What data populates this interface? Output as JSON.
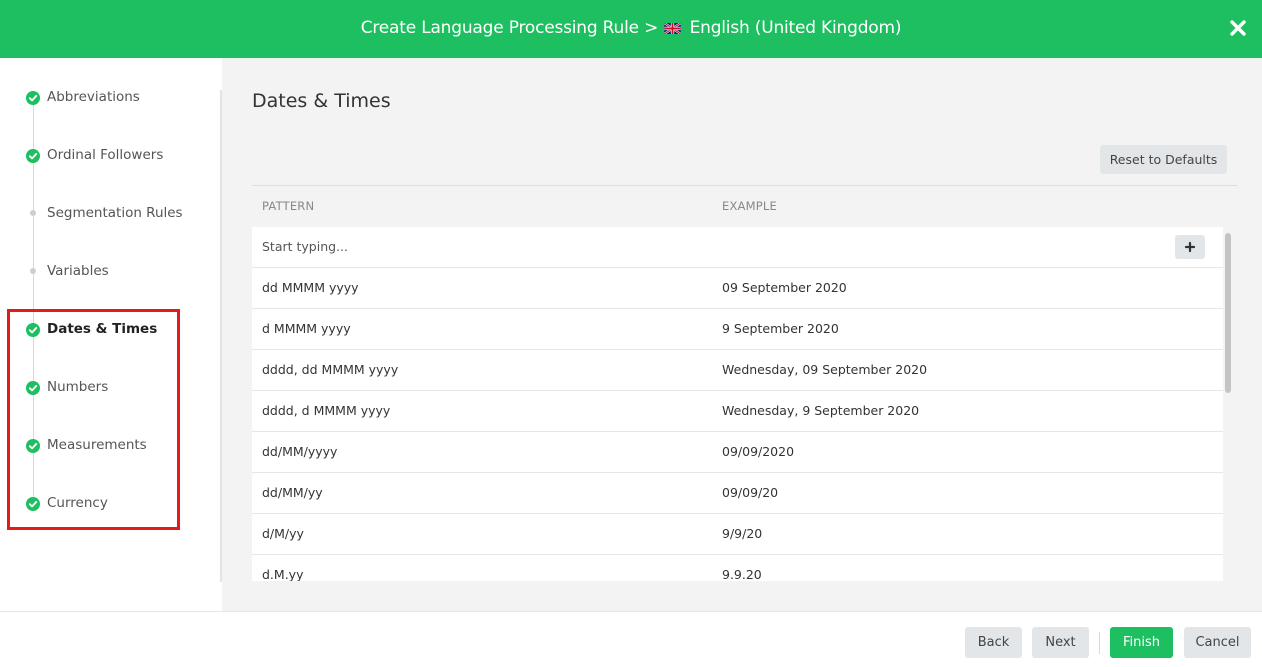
{
  "header": {
    "title": "Create Language Processing Rule >",
    "language": "English (United Kingdom)",
    "flag_icon": "uk-flag-icon",
    "close_icon": "close-icon",
    "bg_color": "#1dbf60"
  },
  "sidebar": {
    "steps": [
      {
        "label": "Abbreviations",
        "status": "complete"
      },
      {
        "label": "Ordinal Followers",
        "status": "complete"
      },
      {
        "label": "Segmentation Rules",
        "status": "pending"
      },
      {
        "label": "Variables",
        "status": "pending"
      },
      {
        "label": "Dates & Times",
        "status": "complete-active"
      },
      {
        "label": "Numbers",
        "status": "complete"
      },
      {
        "label": "Measurements",
        "status": "complete"
      },
      {
        "label": "Currency",
        "status": "complete"
      }
    ]
  },
  "main": {
    "title": "Dates & Times",
    "reset_label": "Reset to Defaults",
    "columns": {
      "pattern": "PATTERN",
      "example": "EXAMPLE"
    },
    "new_row_placeholder": "Start typing...",
    "add_icon": "plus-icon",
    "rows": [
      {
        "pattern": "dd MMMM yyyy",
        "example": "09 September 2020"
      },
      {
        "pattern": "d MMMM yyyy",
        "example": "9 September 2020"
      },
      {
        "pattern": "dddd, dd MMMM yyyy",
        "example": "Wednesday, 09 September 2020"
      },
      {
        "pattern": "dddd, d MMMM yyyy",
        "example": "Wednesday, 9 September 2020"
      },
      {
        "pattern": "dd/MM/yyyy",
        "example": "09/09/2020"
      },
      {
        "pattern": "dd/MM/yy",
        "example": "09/09/20"
      },
      {
        "pattern": "d/M/yy",
        "example": "9/9/20"
      },
      {
        "pattern": "d.M.yy",
        "example": "9.9.20"
      }
    ]
  },
  "footer": {
    "back": "Back",
    "next": "Next",
    "finish": "Finish",
    "cancel": "Cancel"
  }
}
